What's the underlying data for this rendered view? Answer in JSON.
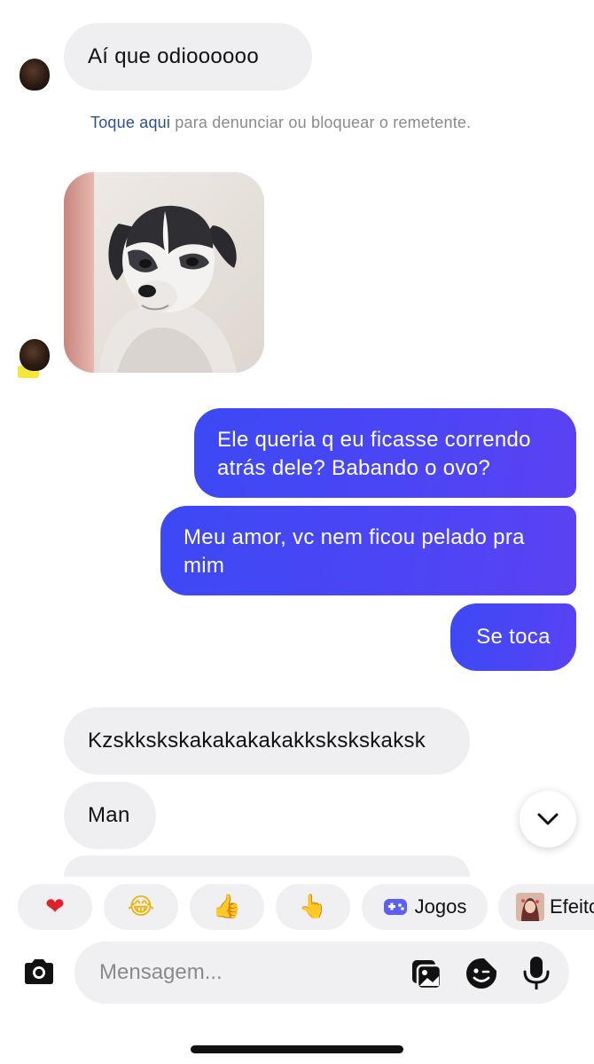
{
  "messages": {
    "incoming_1": "Aí que odioooooo",
    "report": {
      "link": "Toque aqui",
      "text": " para denunciar ou bloquear o remetente."
    },
    "outgoing_1": {
      "line1": "Ele queria q eu ficasse correndo",
      "line2": "atrás dele? Babando o ovo?"
    },
    "outgoing_2": {
      "line1": "Meu amor, vc nem ficou pelado pra",
      "line2": "mim"
    },
    "outgoing_3": "Se toca",
    "incoming_2": "Kzskkskskakakakakakkskskskaksk",
    "incoming_3": "Man"
  },
  "reactions": {
    "heart": "❤",
    "laugh": "😂",
    "thumbs_up": "👍",
    "point": "👆",
    "games_label": "Jogos",
    "effects_label": "Efeito"
  },
  "composer": {
    "placeholder": "Mensagem..."
  },
  "icons": {
    "camera": "camera-icon",
    "gallery": "gallery-icon",
    "sticker": "sticker-icon",
    "mic": "microphone-icon",
    "scroll": "chevron-down-icon",
    "games": "gamepad-icon"
  },
  "colors": {
    "outgoing_bubble": "#4a47f5",
    "incoming_bubble": "#efeff1",
    "link": "#2f4f8f",
    "games_icon": "#5b5ff5"
  }
}
